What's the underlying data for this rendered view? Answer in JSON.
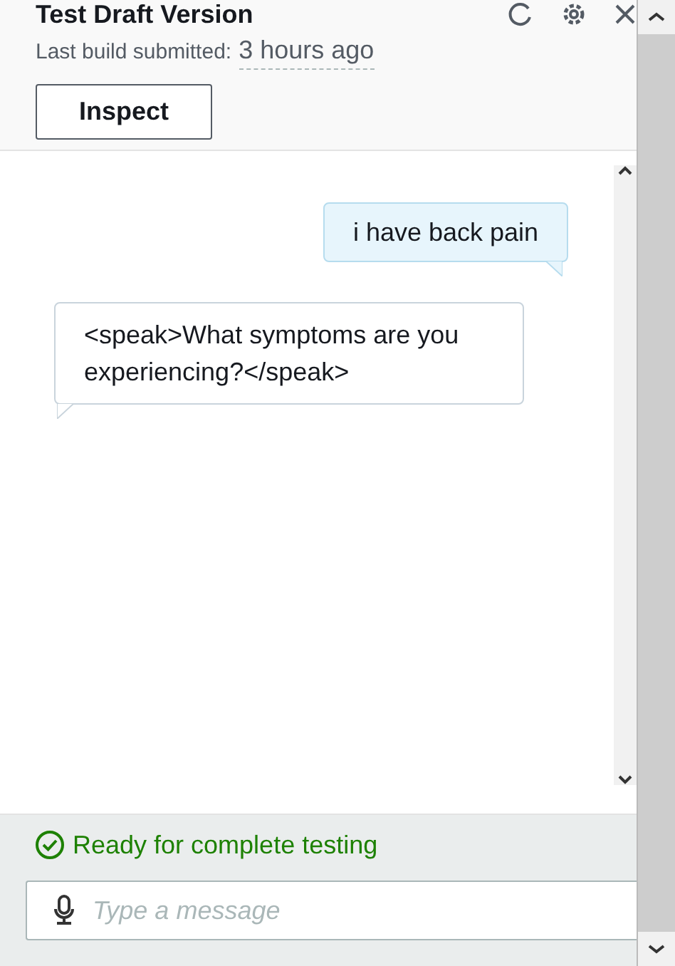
{
  "header": {
    "title": "Test Draft Version",
    "build_label": "Last build submitted:",
    "build_time": "3 hours ago",
    "inspect_button": "Inspect"
  },
  "messages": [
    {
      "kind": "user",
      "text": "i have back pain"
    },
    {
      "kind": "bot",
      "text": "<speak>What symptoms are you experiencing?</speak>"
    }
  ],
  "status": {
    "kind": "ready",
    "text": "Ready for complete testing"
  },
  "input": {
    "placeholder": "Type a message"
  }
}
